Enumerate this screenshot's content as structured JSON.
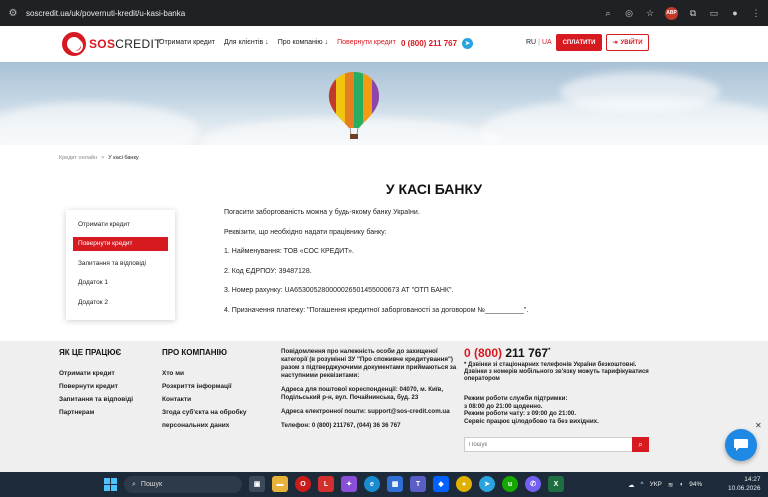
{
  "browser": {
    "url": "soscredit.ua/uk/povernuti-kredit/u-kasi-banka"
  },
  "header": {
    "logo_sos": "SOS",
    "logo_credit": "CREDIT",
    "nav": [
      "Отримати кредит",
      "Для клієнтів ↓",
      "Про компанію ↓",
      "Повернути кредит"
    ],
    "phone": "0 (800) 211 767",
    "lang_ru": "RU",
    "lang_ua": "UA",
    "pay_button": "СПЛАТИТИ",
    "login_button": "УВІЙТИ"
  },
  "breadcrumb": {
    "root": "Кредит онлайн",
    "separator": ">",
    "current": "У касі банку"
  },
  "page_title": "У КАСІ БАНКУ",
  "side_menu": [
    "Отримати кредит",
    "Повернути кредит",
    "Запитання та відповіді",
    "Додаток 1",
    "Додаток 2"
  ],
  "content": [
    "Погасити заборгованість можна у будь-якому банку України.",
    "Реквізити, що необхідно надати працівнику банку:",
    "1. Найменування: ТОВ «СОС КРЕДИТ».",
    "2. Код ЄДРПОУ: 39487128.",
    "3. Номер рахунку: UA653005280000026501455000673 АТ \"ОТП БАНК\".",
    "4. Призначення платежу: \"Погашення кредитної заборгованості за договором №__________\"."
  ],
  "footer": {
    "col1_title": "ЯК ЦЕ ПРАЦЮЄ",
    "col1_links": [
      "Отримати кредит",
      "Повернути кредит",
      "Запитання та відповіді",
      "Партнерам"
    ],
    "col2_title": "ПРО КОМПАНІЮ",
    "col2_links": [
      "Хто ми",
      "Розкриття інформації",
      "Контакти",
      "Згода суб'єкта на обробку персональних даних"
    ],
    "notice": "Повідомлення про належність особи до захищеної категорії (в розумінні ЗУ \"Про споживче кредитування\") разом з підтверджуючими документами приймаються за наступними реквізитами:",
    "postal": "Адреса для поштової кореспонденції: 04070, м. Київ, Подільський р-н, вул. Почайнинська, буд. 23",
    "email": "Адреса електронної пошти: support@sos-credit.com.ua",
    "phones": "Телефон: 0 (800) 211767, (044) 36 36 767",
    "phone_prefix": "0 (800)",
    "phone_main": "211 767",
    "phone_star": "*",
    "free_note": "* Дзвінки зі стаціонарних телефонів України безкоштовні. Дзвінки з номерів мобільного зв'язку можуть тарифікуватися оператором",
    "hours_1": "Режим роботи служби підтримки:",
    "hours_2": "з 08:00 до 21:00 щоденно.",
    "hours_3": "Режим роботи чату: з 09:00 до 21:00.",
    "hours_4": "Сервіс працює цілодобово та без вихідних.",
    "search_placeholder": "Пошук"
  },
  "taskbar": {
    "search_label": "Пошук",
    "lang": "УКР",
    "battery": "94%",
    "time": "14:27",
    "date": "10.06.2026"
  },
  "colors": {
    "brand_red": "#d71920",
    "footer_bg": "#efefef",
    "chat_blue": "#1e88e5"
  }
}
